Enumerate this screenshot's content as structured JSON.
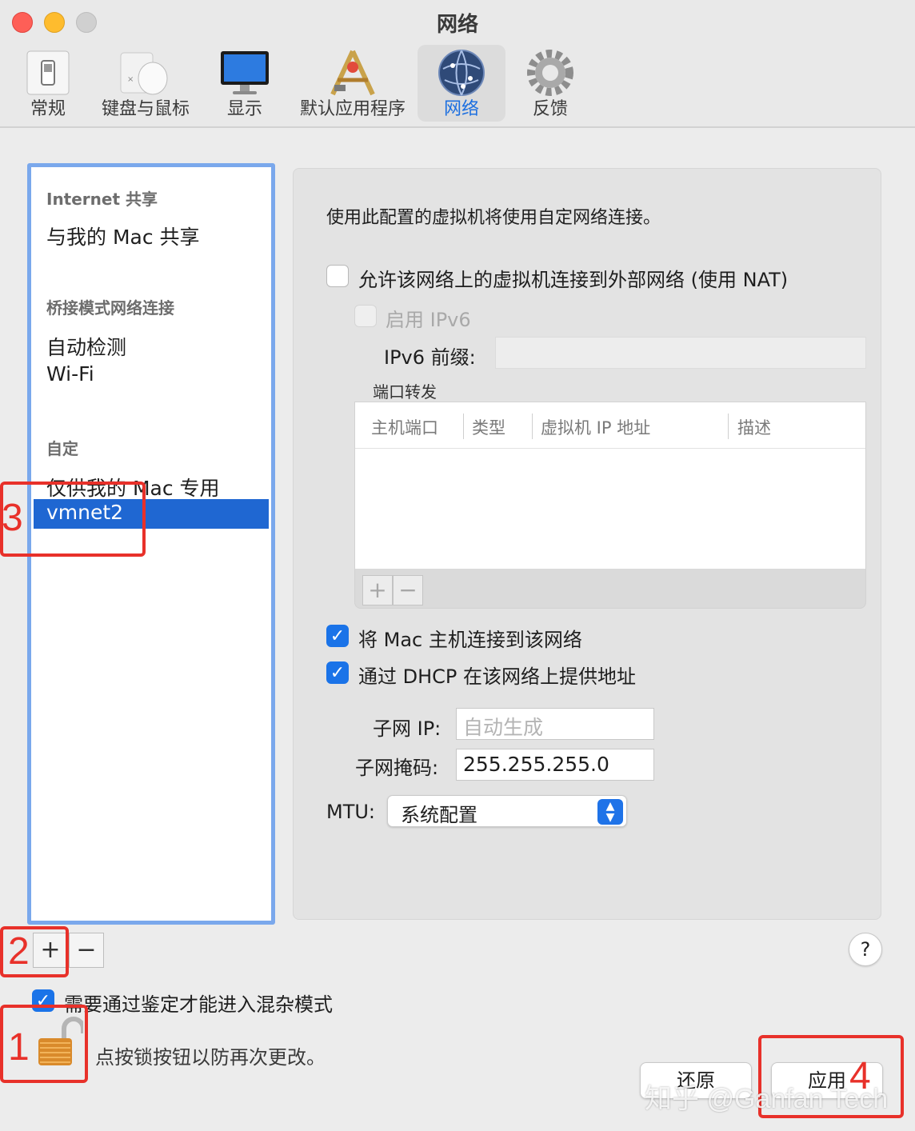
{
  "window": {
    "title": "网络"
  },
  "toolbar": {
    "items": [
      {
        "label": "常规",
        "icon": "switch-icon"
      },
      {
        "label": "键盘与鼠标",
        "icon": "mouse-icon"
      },
      {
        "label": "显示",
        "icon": "display-icon"
      },
      {
        "label": "默认应用程序",
        "icon": "app-tools-icon"
      },
      {
        "label": "网络",
        "icon": "globe-icon",
        "selected": true
      },
      {
        "label": "反馈",
        "icon": "gear-icon"
      }
    ]
  },
  "sidebar": {
    "sections": [
      {
        "header": "Internet 共享",
        "items": [
          "与我的 Mac 共享"
        ]
      },
      {
        "header": "桥接模式网络连接",
        "items": [
          "自动检测",
          "Wi-Fi"
        ]
      },
      {
        "header": "自定",
        "items": [
          "仅供我的 Mac 专用",
          "vmnet2"
        ]
      }
    ],
    "selected": "vmnet2"
  },
  "panel": {
    "description": "使用此配置的虚拟机将使用自定网络连接。",
    "nat_label": "允许该网络上的虚拟机连接到外部网络 (使用 NAT)",
    "ipv6_label": "启用 IPv6",
    "ipv6_prefix_label": "IPv6 前缀:",
    "ipv6_prefix_value": "",
    "port_forward_title": "端口转发",
    "table_headers": [
      "主机端口",
      "类型",
      "虚拟机 IP 地址",
      "描述"
    ],
    "add_symbol": "+",
    "remove_symbol": "−",
    "connect_host_label": "将 Mac 主机连接到该网络",
    "dhcp_label": "通过 DHCP 在该网络上提供地址",
    "subnet_ip_label": "子网 IP:",
    "subnet_ip_placeholder": "自动生成",
    "subnet_mask_label": "子网掩码:",
    "subnet_mask_value": "255.255.255.0",
    "mtu_label": "MTU:",
    "mtu_value": "系统配置",
    "checkbox_states": {
      "nat": false,
      "ipv6": false,
      "connect_host": true,
      "dhcp": true
    }
  },
  "bottom": {
    "add_symbol": "+",
    "remove_symbol": "−",
    "promisc_label": "需要通过鉴定才能进入混杂模式",
    "promisc_checked": true,
    "lock_text": "点按锁按钮以防再次更改。",
    "revert_label": "还原",
    "apply_label": "应用",
    "help_symbol": "?"
  },
  "annotations": [
    "1",
    "2",
    "3",
    "4"
  ],
  "watermark": "知乎 @Ganfan Tech",
  "colors": {
    "accent": "#1f67d2",
    "annotation": "#e8312a",
    "sidebar_border": "#7aa8ec"
  }
}
